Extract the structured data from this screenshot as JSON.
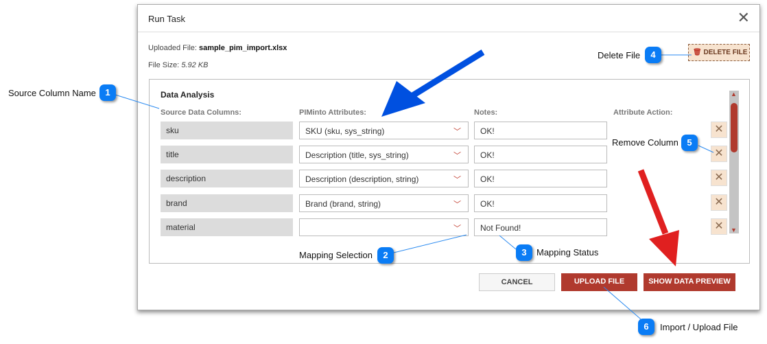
{
  "dialog": {
    "title": "Run Task",
    "uploaded_label": "Uploaded File:",
    "uploaded_value": "sample_pim_import.xlsx",
    "size_label": "File Size:",
    "size_value": "5.92 KB",
    "delete_label": "DELETE FILE",
    "section_title": "Data Analysis",
    "headers": {
      "source": "Source Data Columns:",
      "attributes": "PIMinto Attributes:",
      "notes": "Notes:",
      "action": "Attribute Action:"
    },
    "rows": [
      {
        "source": "sku",
        "attribute": "SKU (sku, sys_string)",
        "note": "OK!"
      },
      {
        "source": "title",
        "attribute": "Description (title, sys_string)",
        "note": "OK!"
      },
      {
        "source": "description",
        "attribute": "Description (description, string)",
        "note": "OK!"
      },
      {
        "source": "brand",
        "attribute": "Brand (brand, string)",
        "note": "OK!"
      },
      {
        "source": "material",
        "attribute": "",
        "note": "Not Found!"
      }
    ],
    "buttons": {
      "cancel": "CANCEL",
      "upload": "UPLOAD FILE",
      "preview": "SHOW DATA PREVIEW"
    }
  },
  "annotations": [
    {
      "n": "1",
      "text": "Source Column Name"
    },
    {
      "n": "2",
      "text": "Mapping Selection"
    },
    {
      "n": "3",
      "text": "Mapping Status"
    },
    {
      "n": "4",
      "text": "Delete File"
    },
    {
      "n": "5",
      "text": "Remove Column"
    },
    {
      "n": "6",
      "text": "Import / Upload File"
    }
  ],
  "colors": {
    "accent": "#b03a2e",
    "bubble": "#0a7cf5",
    "arrow_blue": "#0050e0",
    "arrow_red": "#e02020"
  }
}
